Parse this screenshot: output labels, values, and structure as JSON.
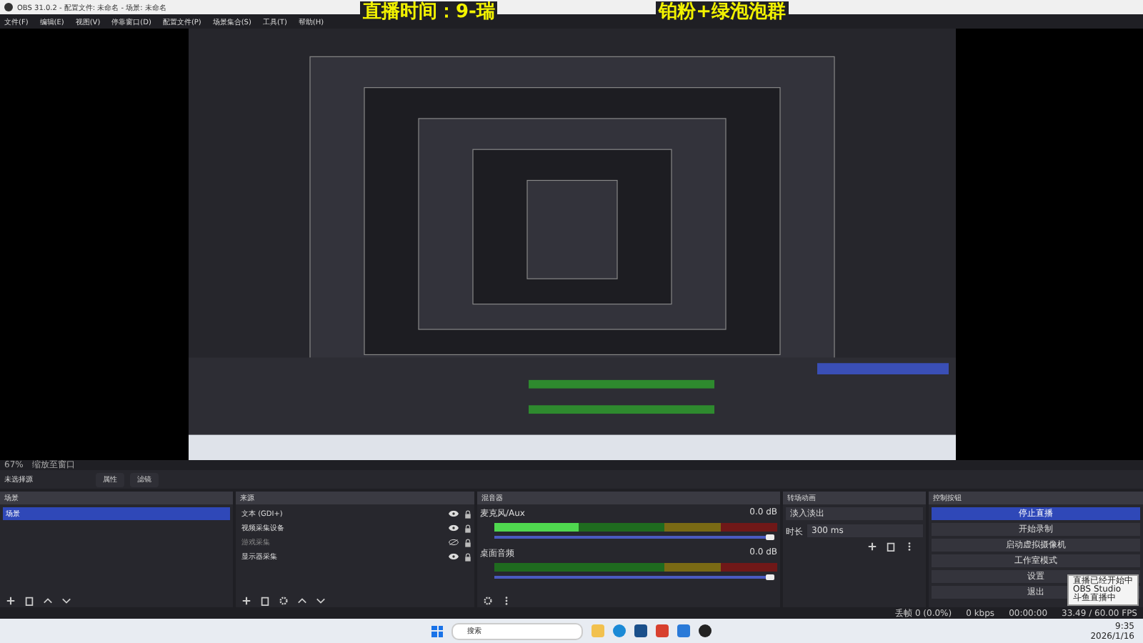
{
  "window": {
    "title": "OBS 31.0.2 - 配置文件: 未命名 - 场景: 未命名"
  },
  "menu": [
    "文件(F)",
    "编辑(E)",
    "视图(V)",
    "停靠窗口(D)",
    "配置文件(P)",
    "场景集合(S)",
    "工具(T)",
    "帮助(H)"
  ],
  "overlay_text": [
    {
      "text": "直播时间：9-瑞"
    },
    {
      "text": "铂粉+绿泡泡群"
    }
  ],
  "preview": {
    "kind": "picture",
    "zoom": "67%",
    "zoom_mode": "缩放至窗口"
  },
  "source_bar": {
    "label": "未选择源",
    "buttons": [
      "属性",
      "滤镜"
    ]
  },
  "scenes": {
    "title": "场景",
    "items": [
      {
        "name": "场景",
        "selected": true
      }
    ]
  },
  "sources": {
    "title": "来源",
    "items": [
      {
        "name": "文本 (GDI+)",
        "visible": true
      },
      {
        "name": "视频采集设备",
        "visible": true
      },
      {
        "name": "游戏采集",
        "visible": false
      },
      {
        "name": "显示器采集",
        "visible": true
      }
    ]
  },
  "mixer": {
    "title": "混音器",
    "channels": [
      {
        "name": "麦克风/Aux",
        "reading": "0.0 dB",
        "level": 0.3,
        "volume": {
          "level": 1
        }
      },
      {
        "name": "桌面音频",
        "reading": "0.0 dB",
        "level": 0,
        "volume": {
          "level": 1
        }
      }
    ]
  },
  "transitions": {
    "title": "转场动画",
    "type": "淡入淡出",
    "duration_label": "时长",
    "duration": "300 ms"
  },
  "controls": {
    "title": "控制按钮",
    "buttons": [
      {
        "label": "停止直播",
        "active": true
      },
      {
        "label": "开始录制",
        "active": false
      },
      {
        "label": "启动虚拟摄像机",
        "active": false
      },
      {
        "label": "工作室模式",
        "active": false
      },
      {
        "label": "设置",
        "active": false
      },
      {
        "label": "退出",
        "active": false
      }
    ]
  },
  "tooltip": [
    "直播已经开始中",
    "OBS Studio",
    "斗鱼直播中"
  ],
  "status_bar": {
    "dropped": "丢帧 0 (0.0%)",
    "kbps": "0 kbps",
    "time": "00:00:00",
    "fps": "33.49 / 60.00 FPS"
  },
  "taskbar": {
    "search": "搜索",
    "time": "9:35",
    "date": "2026/1/16"
  }
}
